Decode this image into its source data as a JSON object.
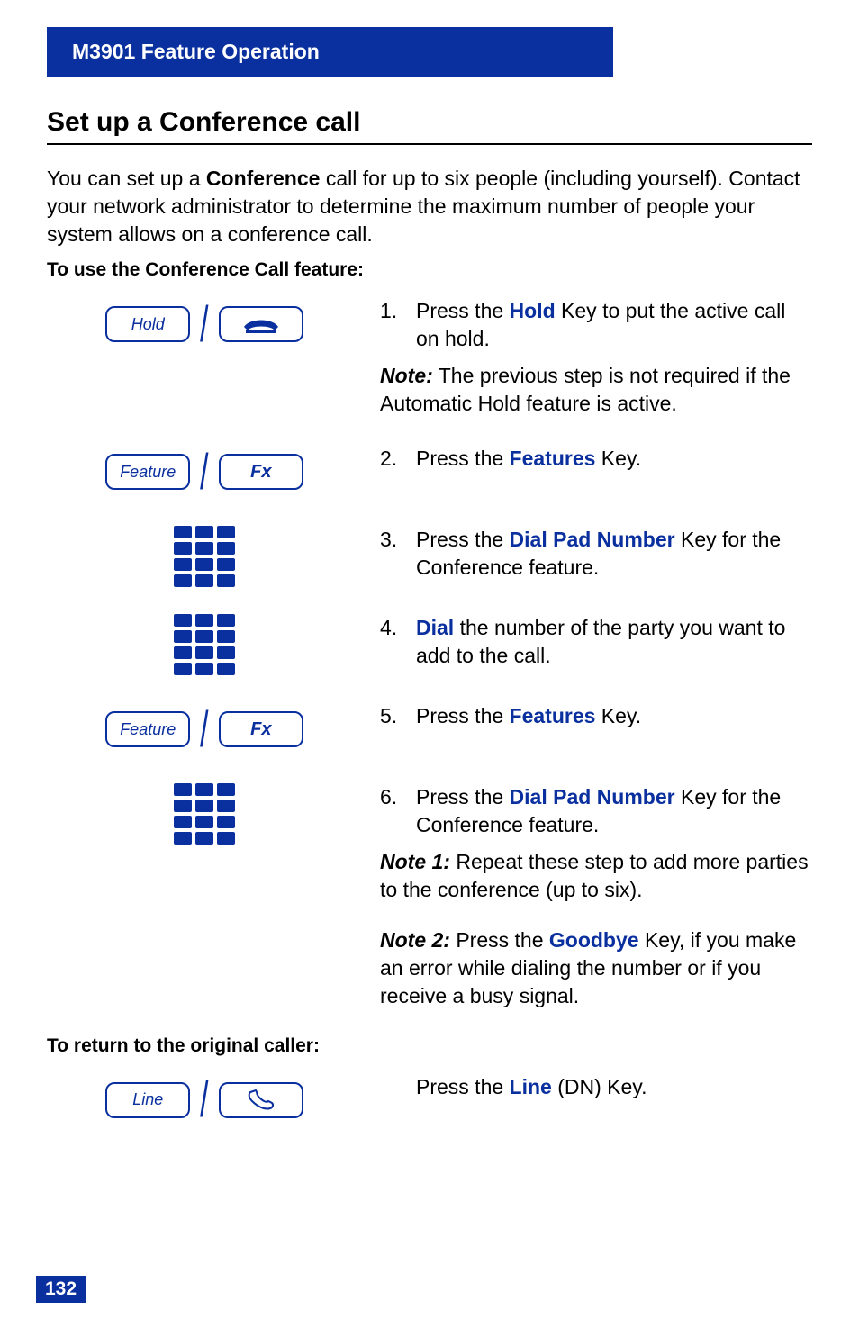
{
  "header": {
    "title": "M3901 Feature Operation"
  },
  "section": {
    "title": "Set up a Conference call",
    "intro_pre": "You can set up a ",
    "intro_bold": "Conference",
    "intro_post": " call for up to six people (including yourself). Contact your network administrator to determine the maximum number of people your system allows on a conference call.",
    "use_heading": "To use the Conference Call feature:",
    "return_heading": "To return to the original caller:"
  },
  "keys": {
    "hold": "Hold",
    "feature": "Feature",
    "fx": "Fx",
    "line": "Line"
  },
  "steps": {
    "s1_num": "1.",
    "s1_a": "Press the ",
    "s1_key": "Hold",
    "s1_b": " Key to put the active call on hold.",
    "s1_note_label": "Note:",
    "s1_note_text": " The previous step is not required if the Automatic Hold feature is active.",
    "s2_num": "2.",
    "s2_a": "Press the ",
    "s2_key": "Features",
    "s2_b": " Key.",
    "s3_num": "3.",
    "s3_a": "Press the ",
    "s3_key": "Dial Pad Number",
    "s3_b": " Key for the Conference feature.",
    "s4_num": "4.",
    "s4_key": "Dial",
    "s4_b": " the number of the party you want to add to the call.",
    "s5_num": "5.",
    "s5_a": "Press the ",
    "s5_key": "Features",
    "s5_b": " Key.",
    "s6_num": "6.",
    "s6_a": "Press the ",
    "s6_key": "Dial Pad Number",
    "s6_b": " Key for the Conference feature.",
    "s6_note1_label": "Note 1:",
    "s6_note1_text": "  Repeat these step to add more parties to the conference (up to six).",
    "s6_note2_label": "Note 2:",
    "s6_note2_a": "   Press the ",
    "s6_note2_key": "Goodbye",
    "s6_note2_b": " Key, if you make an error while dialing the number or if you receive a busy signal.",
    "ret_a": "Press the ",
    "ret_key": "Line",
    "ret_b": " (DN) Key."
  },
  "page_number": "132"
}
